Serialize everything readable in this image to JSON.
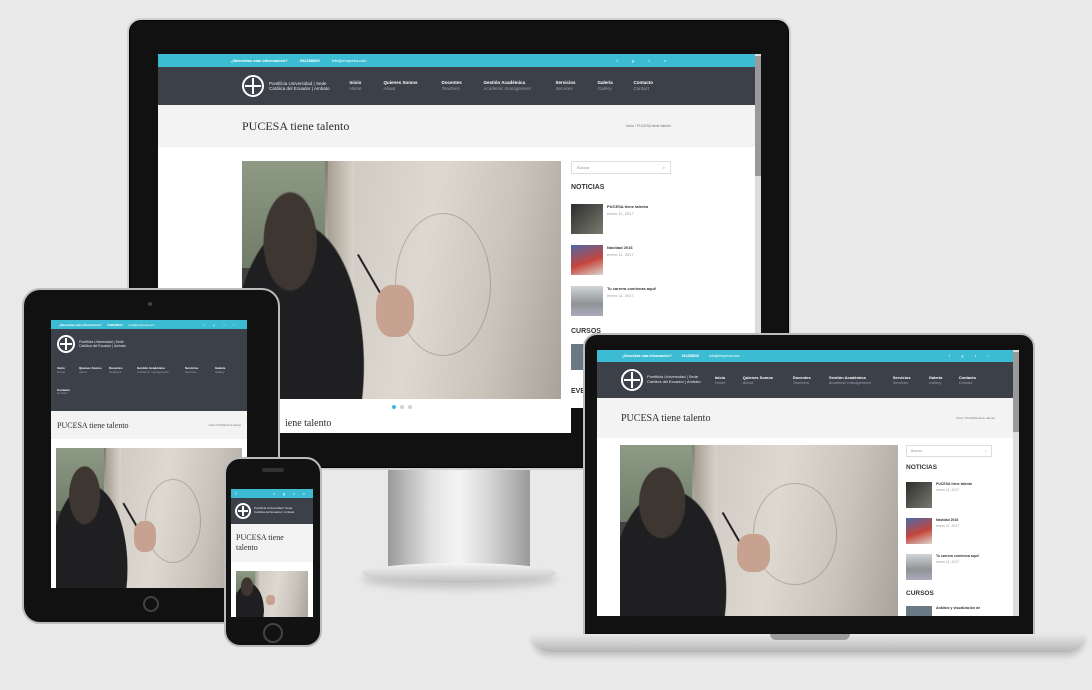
{
  "site": {
    "topbar": {
      "question": "¿Necesitas más información?",
      "phone": "032258000",
      "email": "info@empresa.com",
      "social_icons": [
        "facebook-icon",
        "google-plus-icon",
        "twitter-icon",
        "search-icon"
      ],
      "social_glyphs": [
        "f",
        "g",
        "t",
        "⌕"
      ]
    },
    "logo": {
      "line1": "Pontificia Universidad | Sede",
      "line2": "Católica del Ecuador  | Ambato"
    },
    "menu": [
      {
        "label": "Inicio",
        "sub": "Home"
      },
      {
        "label": "Quienes Somos",
        "sub": "About"
      },
      {
        "label": "Docentes",
        "sub": "Teachers"
      },
      {
        "label": "Gestión Académica",
        "sub": "Academic management"
      },
      {
        "label": "Servicios",
        "sub": "Services"
      },
      {
        "label": "Galería",
        "sub": "Gallery"
      },
      {
        "label": "Contacto",
        "sub": "Contact"
      }
    ],
    "page_title": "PUCESA tiene talento",
    "breadcrumb": "Inicio / PUCESA tiene talento",
    "search_placeholder": "Buscar",
    "sidebar": {
      "news_heading": "NOTICIAS",
      "courses_heading": "CURSOS",
      "events_heading": "EVE",
      "news": [
        {
          "title": "PUCESA tiene talento",
          "date": "enero 11, 2017"
        },
        {
          "title": "Navidad 2016",
          "date": "enero 11, 2017"
        },
        {
          "title": "Tu carrera comienza aquí!",
          "date": "enero 11, 2017"
        }
      ],
      "course_title": "Análisis y visualización de"
    },
    "caption": "iene talento",
    "tablet_menu": [
      {
        "label": "Inicio",
        "sub": "Home"
      },
      {
        "label": "Quienes Somos",
        "sub": "About"
      },
      {
        "label": "Docentes",
        "sub": "Teachers"
      },
      {
        "label": "Gestión Académica",
        "sub": "Academic management"
      },
      {
        "label": "Servicios",
        "sub": "Services"
      },
      {
        "label": "Galería",
        "sub": "Gallery"
      },
      {
        "label": "Contacto",
        "sub": "Contact"
      }
    ]
  },
  "colors": {
    "accent": "#3cbcd3",
    "nav": "#3c4049",
    "titlebar": "#f3f3f3"
  }
}
